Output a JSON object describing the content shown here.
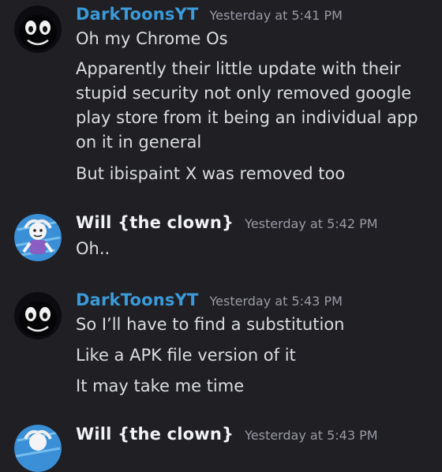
{
  "colors": {
    "background": "#1f1f24",
    "darktoons_name": "#3b9ad9",
    "will_name": "#f2f3f5",
    "timestamp": "#9a9ba3",
    "text": "#dbdee1"
  },
  "messages": [
    {
      "author": "DarkToonsYT",
      "timestamp": "Yesterday at 5:41 PM",
      "avatar_icon": "dark-creature-avatar",
      "lines": [
        "Oh my Chrome Os",
        "Apparently their little update with their stupid security not only removed google play store from it being an individual app on it in general",
        "But ibispaint X was removed too"
      ]
    },
    {
      "author": "Will {the clown}",
      "timestamp": "Yesterday at 5:42 PM",
      "avatar_icon": "clown-character-avatar",
      "lines": [
        "Oh.."
      ]
    },
    {
      "author": "DarkToonsYT",
      "timestamp": "Yesterday at 5:43 PM",
      "avatar_icon": "dark-creature-avatar",
      "lines": [
        "So I’ll have to find a substitution",
        "Like a APK file version of it",
        "It may take me time"
      ]
    },
    {
      "author": "Will {the clown}",
      "timestamp": "Yesterday at 5:43 PM",
      "avatar_icon": "clown-character-avatar",
      "lines": []
    }
  ]
}
